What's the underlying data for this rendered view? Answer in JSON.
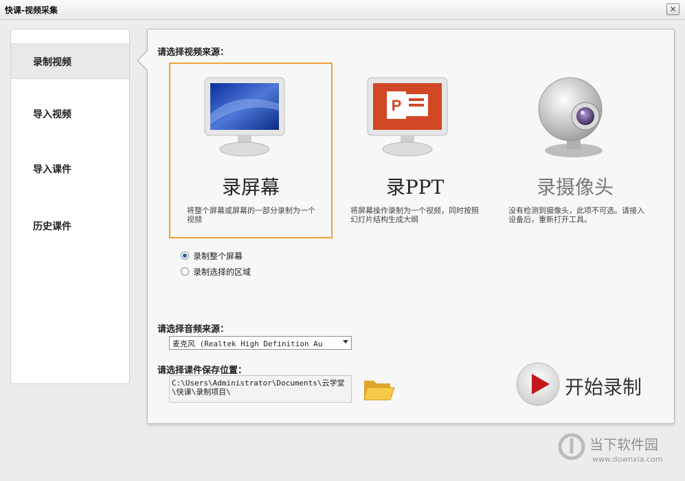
{
  "window": {
    "title": "快课-视频采集",
    "close_glyph": "×"
  },
  "sidebar": {
    "items": [
      {
        "label": "录制视频",
        "active": true
      },
      {
        "label": "导入视频",
        "active": false
      },
      {
        "label": "导入课件",
        "active": false
      },
      {
        "label": "历史课件",
        "active": false
      }
    ]
  },
  "main": {
    "video_source_label": "请选择视频来源：",
    "sources": [
      {
        "title": "录屏幕",
        "desc": "将整个屏幕或屏幕的一部分录制为一个视频",
        "selected": true,
        "enabled": true
      },
      {
        "title": "录PPT",
        "desc": "将屏幕操作录制为一个视频，同时按照幻灯片结构生成大纲",
        "selected": false,
        "enabled": true
      },
      {
        "title": "录摄像头",
        "desc": "没有检测到摄像头，此项不可选。请接入设备后，重新打开工具。",
        "selected": false,
        "enabled": false
      }
    ],
    "record_mode": {
      "options": [
        {
          "label": "录制整个屏幕",
          "checked": true
        },
        {
          "label": "录制选择的区域",
          "checked": false
        }
      ]
    },
    "audio_source_label": "请选择音频来源：",
    "audio_source_value": "麦克风 (Realtek High Definition Au",
    "save_location_label": "请选择课件保存位置：",
    "save_location_value": "C:\\Users\\Administrator\\Documents\\云学堂\\快课\\录制项目\\",
    "start_button_label": "开始录制"
  },
  "watermark": {
    "name": "当下软件园",
    "url": "www.downxia.com"
  },
  "colors": {
    "selected_border": "#f0a233",
    "radio_active": "#2a5da8",
    "start_icon": "#c4161c"
  }
}
